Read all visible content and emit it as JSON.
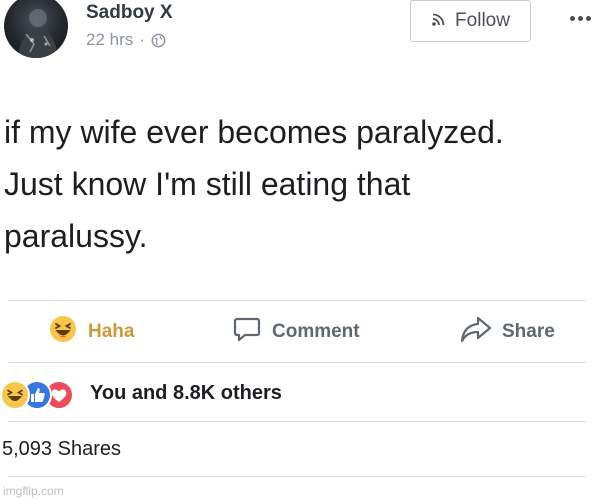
{
  "post": {
    "author": "Sadboy X",
    "time": "22 hrs",
    "separator": "·",
    "privacy_icon": "globe-icon",
    "follow_label": "Follow",
    "follow_icon": "rss-icon",
    "more_icon": "more-dots-icon",
    "text_lines": [
      "if my wife ever becomes paralyzed.",
      "Just know I'm still eating that",
      "paralussy."
    ]
  },
  "actions": [
    {
      "label": "Haha",
      "icon": "haha-emoji-icon"
    },
    {
      "label": "Comment",
      "icon": "comment-icon"
    },
    {
      "label": "Share",
      "icon": "share-icon"
    }
  ],
  "reactions": {
    "icons": [
      "haha-reaction-icon",
      "like-reaction-icon",
      "love-reaction-icon"
    ],
    "summary": "You and 8.8K others"
  },
  "shares": "5,093 Shares",
  "watermark": "imgflip.com",
  "colors": {
    "text": "#1c1e21",
    "muted": "#606770",
    "haha": "#f7c64a",
    "like": "#3578e5",
    "love": "#ed4a5a",
    "divider": "#dadde1"
  }
}
